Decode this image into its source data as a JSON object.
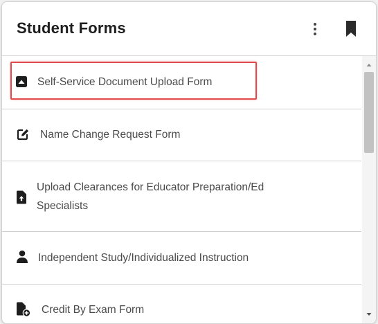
{
  "header": {
    "title": "Student Forms",
    "more_icon": "more-vert-icon",
    "bookmark_icon": "bookmark-icon"
  },
  "forms": [
    {
      "label": "Self-Service Document Upload Form",
      "icon": "upload-box-icon"
    },
    {
      "label": "Name Change Request Form",
      "icon": "edit-icon"
    },
    {
      "label_line1": "Upload Clearances for Educator Preparation/Ed",
      "label_line2": "Specialists",
      "icon": "file-upload-icon"
    },
    {
      "label": "Independent Study/Individualized Instruction",
      "icon": "person-icon"
    },
    {
      "label": "Credit By Exam Form",
      "icon": "file-add-icon"
    }
  ],
  "colors": {
    "highlight": "#e24a4a",
    "icon": "#1e1e1e",
    "text": "#4a4a4a"
  }
}
